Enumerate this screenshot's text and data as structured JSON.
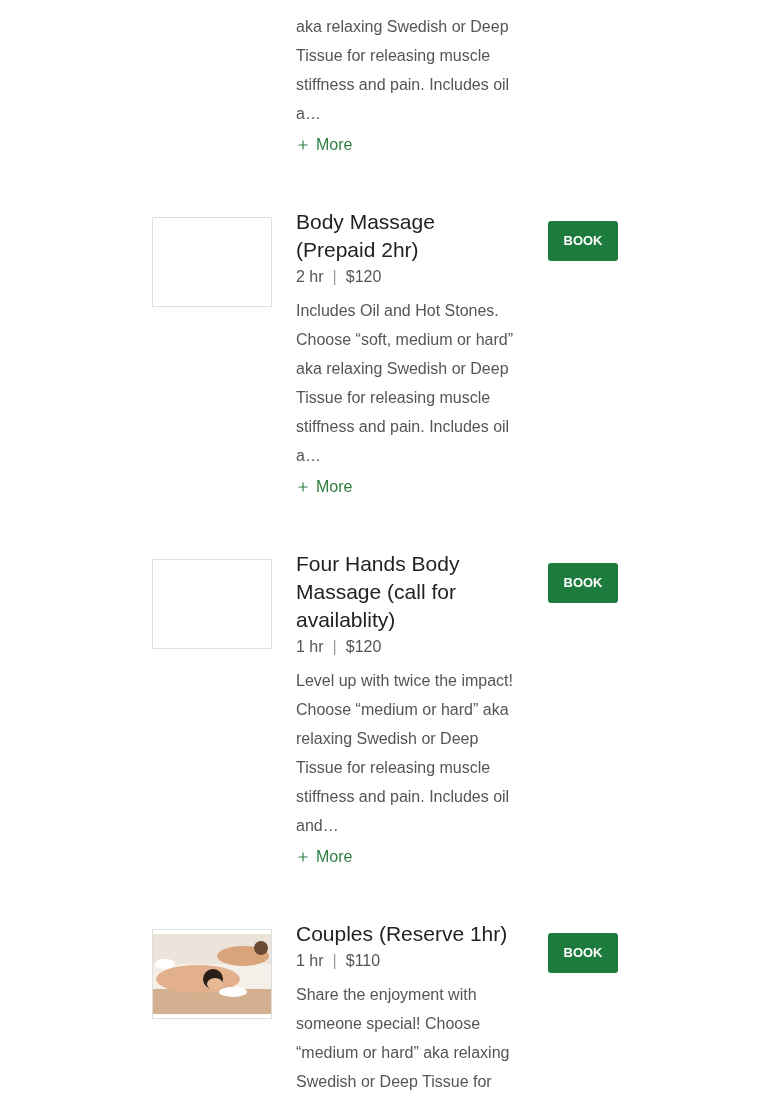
{
  "services": [
    {
      "description": "aka relaxing Swedish or Deep Tissue for releasing muscle stiffness and pain. Includes oil a…",
      "more": "More"
    },
    {
      "thumbnail": {
        "kind": "empty"
      },
      "title": "Body Massage (Prepaid 2hr)",
      "duration": "2 hr",
      "separator": "|",
      "price": "$120",
      "description": "Includes Oil and Hot Stones. Choose “soft, medium or hard” aka relaxing Swedish or Deep Tissue for releasing muscle stiffness and pain. Includes oil a…",
      "more": "More",
      "button": "BOOK"
    },
    {
      "thumbnail": {
        "kind": "empty"
      },
      "title": "Four Hands Body Massage (call for availablity)",
      "duration": "1 hr",
      "separator": "|",
      "price": "$120",
      "description": "Level up with twice the impact! Choose “medium or hard” aka relaxing Swedish or Deep Tissue for releasing muscle stiffness and pain. Includes oil and…",
      "more": "More",
      "button": "BOOK"
    },
    {
      "title": "Couples (Reserve 1hr)",
      "duration": "1 hr",
      "separator": "|",
      "price": "$110",
      "description": "Share the enjoyment with someone special! Choose “medium or hard” aka relaxing Swedish or Deep Tissue for",
      "button": "BOOK"
    }
  ]
}
